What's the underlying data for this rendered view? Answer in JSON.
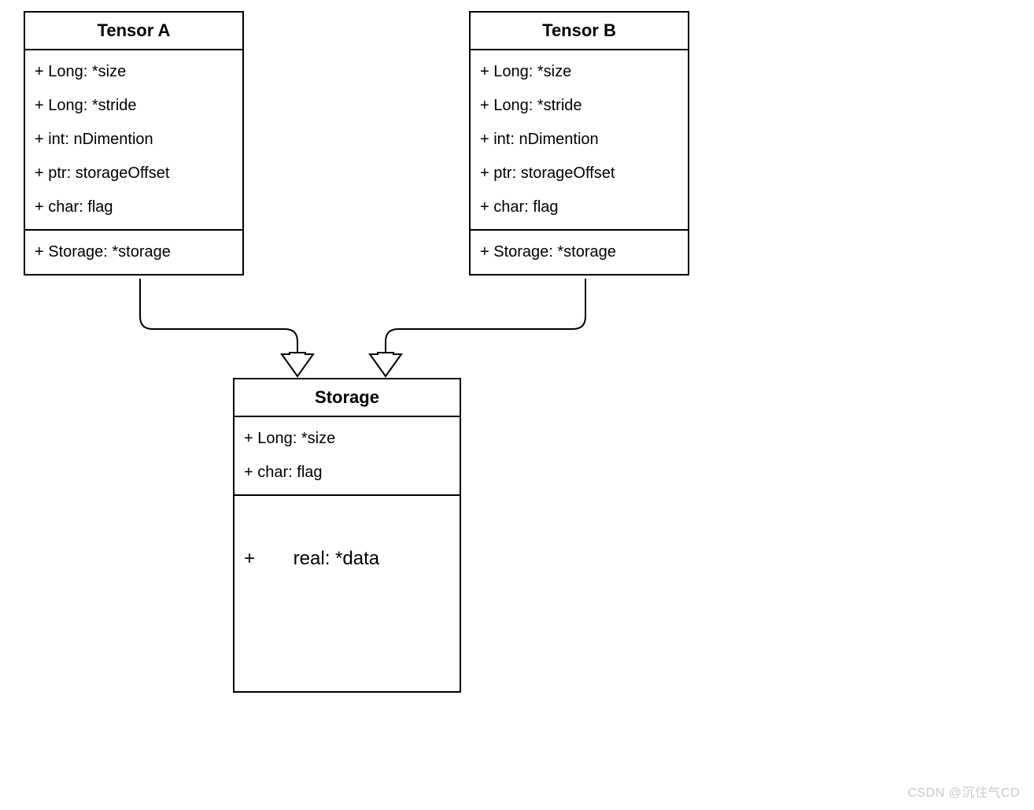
{
  "tensorA": {
    "title": "Tensor A",
    "attrs": [
      "+ Long: *size",
      "+ Long: *stride",
      "+ int:  nDimention",
      "+ ptr: storageOffset",
      "+ char: flag"
    ],
    "storageRef": "+ Storage: *storage"
  },
  "tensorB": {
    "title": "Tensor B",
    "attrs": [
      "+ Long: *size",
      "+ Long: *stride",
      "+ int:  nDimention",
      "+ ptr: storageOffset",
      "+ char: flag"
    ],
    "storageRef": "+ Storage: *storage"
  },
  "storage": {
    "title": "Storage",
    "attrs": [
      "+ Long: *size",
      "+ char: flag"
    ],
    "dataPlus": "+",
    "dataLabel": "real: *data"
  },
  "watermark": "CSDN @沉住气CD"
}
